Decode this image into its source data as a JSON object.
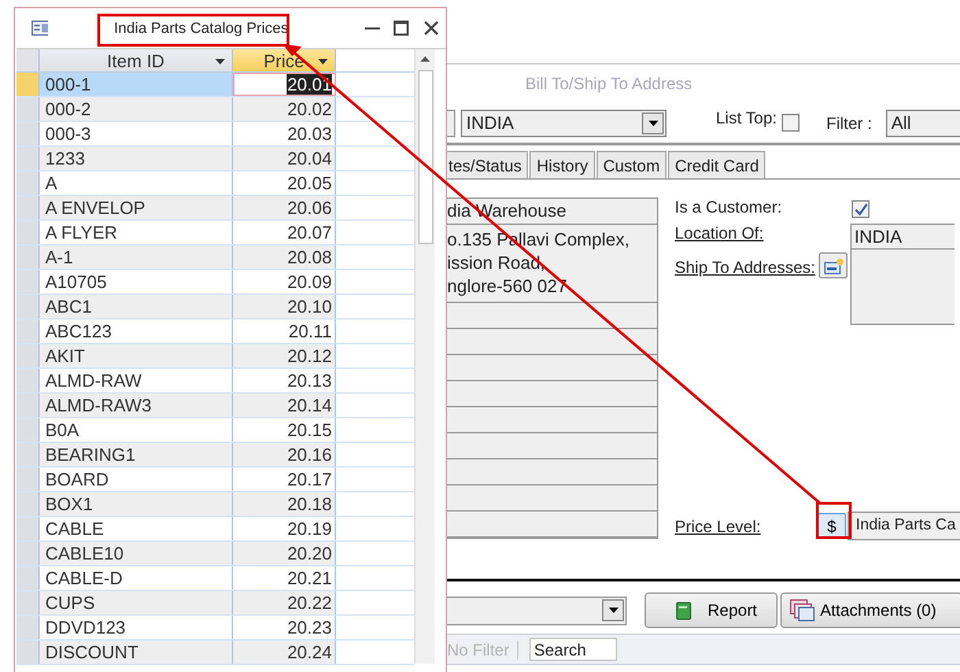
{
  "form": {
    "section_title": "Bill To/Ship To Address",
    "location_combo": {
      "value": "INDIA"
    },
    "list_top": {
      "label": "List Top:",
      "checked": false
    },
    "filter": {
      "label": "Filter :",
      "value": "All"
    },
    "tabs": [
      {
        "label": "tes/Status",
        "selected": false
      },
      {
        "label": "History",
        "selected": false
      },
      {
        "label": "Custom",
        "selected": false
      },
      {
        "label": "Credit Card",
        "selected": false
      }
    ],
    "address": {
      "name": "dia Warehouse",
      "lines": "o.135 Pallavi Complex,\nission Road,\nnglore-560 027"
    },
    "is_customer": {
      "label": "Is a Customer:",
      "checked": true
    },
    "location_of": {
      "label": "Location Of:",
      "value": "INDIA"
    },
    "ship_to": {
      "label": "Ship To Addresses:"
    },
    "price_level": {
      "label": "Price Level:",
      "button": "$",
      "value": "India Parts Ca"
    },
    "report_button": "Report",
    "attachments_button": "Attachments (0)",
    "nav": {
      "no_filter": "No Filter",
      "no_filter_disabled": true,
      "search_placeholder": "Search"
    }
  },
  "popup": {
    "title": "India Parts Catalog Prices",
    "columns": [
      {
        "label": "Item ID",
        "selected": false
      },
      {
        "label": "Price",
        "selected": true
      }
    ],
    "rows": [
      {
        "item_id": "000-1",
        "price": "20.01",
        "selected": true
      },
      {
        "item_id": "000-2",
        "price": "20.02",
        "selected": false
      },
      {
        "item_id": "000-3",
        "price": "20.03",
        "selected": false
      },
      {
        "item_id": "1233",
        "price": "20.04",
        "selected": false
      },
      {
        "item_id": "A",
        "price": "20.05",
        "selected": false
      },
      {
        "item_id": "A ENVELOP",
        "price": "20.06",
        "selected": false
      },
      {
        "item_id": "A FLYER",
        "price": "20.07",
        "selected": false
      },
      {
        "item_id": "A-1",
        "price": "20.08",
        "selected": false
      },
      {
        "item_id": "A10705",
        "price": "20.09",
        "selected": false
      },
      {
        "item_id": "ABC1",
        "price": "20.10",
        "selected": false
      },
      {
        "item_id": "ABC123",
        "price": "20.11",
        "selected": false
      },
      {
        "item_id": "AKIT",
        "price": "20.12",
        "selected": false
      },
      {
        "item_id": "ALMD-RAW",
        "price": "20.13",
        "selected": false
      },
      {
        "item_id": "ALMD-RAW3",
        "price": "20.14",
        "selected": false
      },
      {
        "item_id": "B0A",
        "price": "20.15",
        "selected": false
      },
      {
        "item_id": "BEARING1",
        "price": "20.16",
        "selected": false
      },
      {
        "item_id": "BOARD",
        "price": "20.17",
        "selected": false
      },
      {
        "item_id": "BOX1",
        "price": "20.18",
        "selected": false
      },
      {
        "item_id": "CABLE",
        "price": "20.19",
        "selected": false
      },
      {
        "item_id": "CABLE10",
        "price": "20.20",
        "selected": false
      },
      {
        "item_id": "CABLE-D",
        "price": "20.21",
        "selected": false
      },
      {
        "item_id": "CUPS",
        "price": "20.22",
        "selected": false
      },
      {
        "item_id": "DDVD123",
        "price": "20.23",
        "selected": false
      },
      {
        "item_id": "DISCOUNT",
        "price": "20.24",
        "selected": false
      }
    ]
  }
}
